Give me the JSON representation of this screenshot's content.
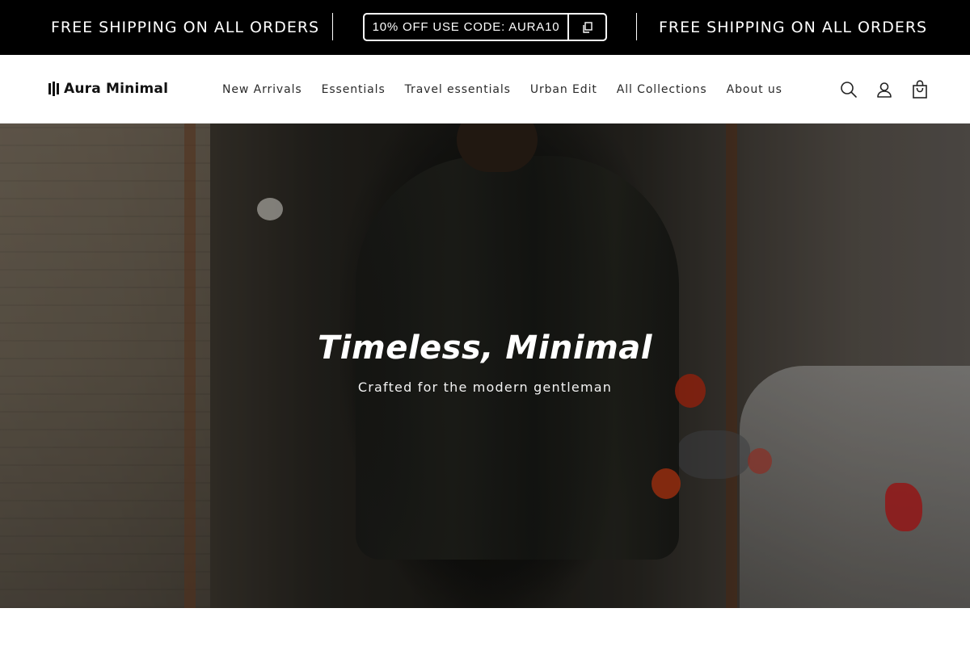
{
  "announcement": {
    "shipping_left": "FREE SHIPPING ON ALL ORDERS",
    "promo_code_text": "10% OFF USE CODE: AURA10",
    "copy_icon": "copy-icon",
    "shipping_right": "FREE SHIPPING ON ALL ORDERS"
  },
  "header": {
    "logo_text": "Aura Minimal",
    "nav": [
      "New Arrivals",
      "Essentials",
      "Travel essentials",
      "Urban Edit",
      "All Collections",
      "About us"
    ],
    "icons": [
      "search-icon",
      "account-icon",
      "cart-icon"
    ]
  },
  "hero": {
    "title": "Timeless, Minimal",
    "subtitle": "Crafted for the modern gentleman"
  },
  "colors": {
    "announcement_bg": "#000000",
    "header_bg": "#ffffff",
    "hero_text": "#ffffff"
  }
}
